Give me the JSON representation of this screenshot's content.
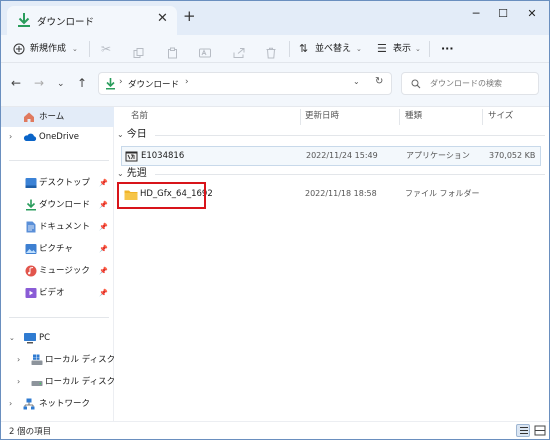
{
  "window": {
    "tab_title": "ダウンロード",
    "tab_close": "✕",
    "tab_new": "+",
    "minimize": "─",
    "maximize": "☐",
    "close": "✕"
  },
  "toolbar": {
    "new_label": "新規作成",
    "sort_label": "並べ替え",
    "view_label": "表示",
    "more": "···"
  },
  "address": {
    "path": "ダウンロード",
    "separator": "›",
    "search_placeholder": "ダウンロードの検索"
  },
  "sidebar": {
    "home": "ホーム",
    "onedrive": "OneDrive",
    "desktop": "デスクトップ",
    "downloads": "ダウンロード",
    "documents": "ドキュメント",
    "pictures": "ピクチャ",
    "music": "ミュージック",
    "videos": "ビデオ",
    "pc": "PC",
    "drive_c": "ローカル ディスク (C:)",
    "drive_d": "ローカル ディスク (D:)",
    "network": "ネットワーク"
  },
  "columns": {
    "name": "名前",
    "date": "更新日時",
    "type": "種類",
    "size": "サイズ"
  },
  "groups": [
    {
      "title": "今日",
      "items": [
        {
          "name": "E1034816",
          "date": "2022/11/24 15:49",
          "type": "アプリケーション",
          "size": "370,052 KB"
        }
      ]
    },
    {
      "title": "先週",
      "items": [
        {
          "name": "HD_Gfx_64_1692",
          "date": "2022/11/18 18:58",
          "type": "ファイル フォルダー",
          "size": ""
        }
      ]
    }
  ],
  "status": {
    "item_count": "2 個の項目"
  },
  "colors": {
    "accent": "#0067c0",
    "folder": "#f6c549",
    "highlight": "#d8141a",
    "download_green": "#2a9d5c"
  }
}
